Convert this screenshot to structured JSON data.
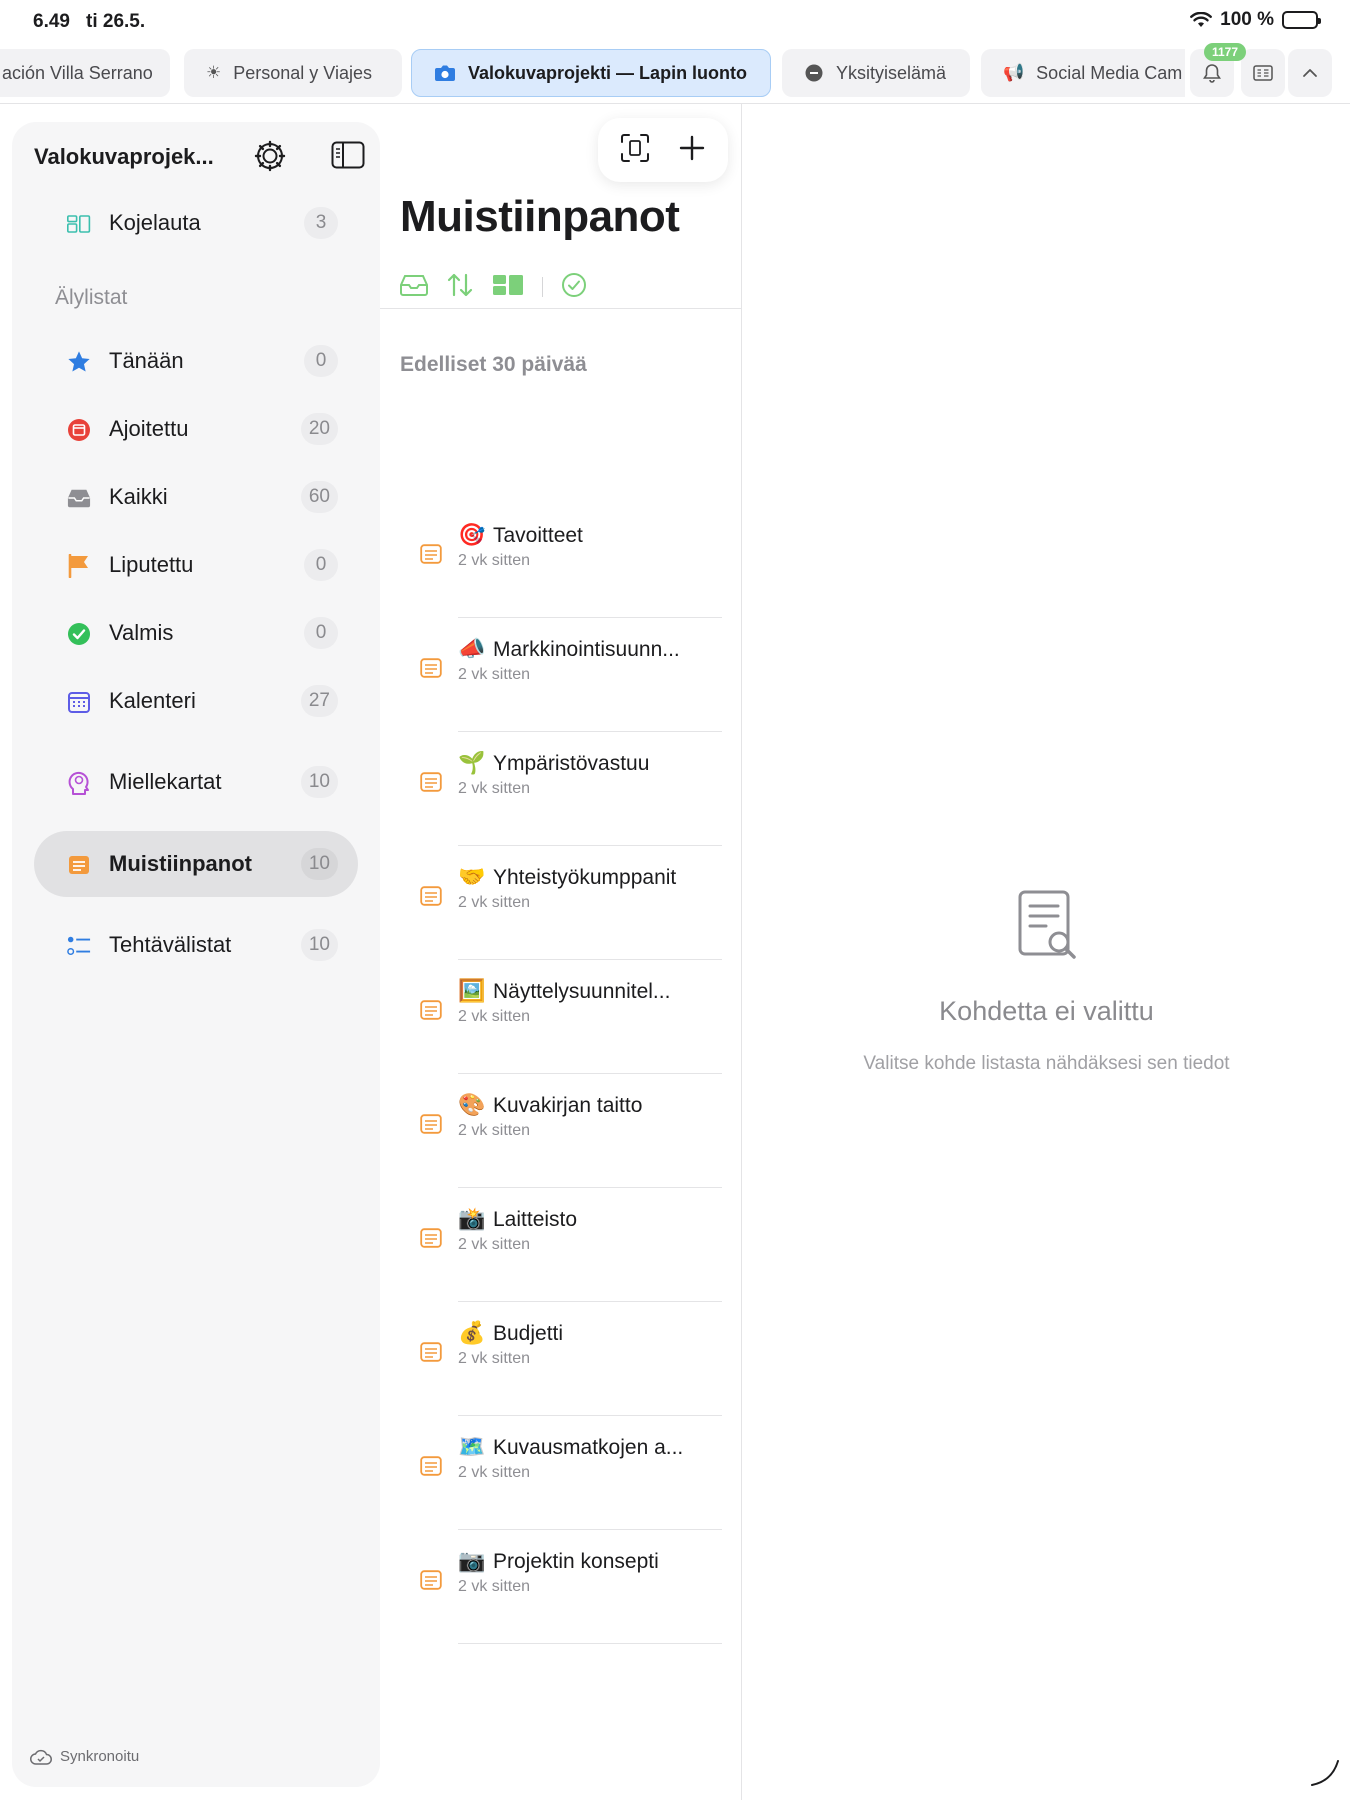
{
  "status": {
    "time": "6.49",
    "date": "ti 26.5.",
    "battery": "100 %"
  },
  "tabs": [
    {
      "label": "ación Villa Serrano",
      "icon": "none"
    },
    {
      "label": "Personal y Viajes",
      "icon": "sun-icon"
    },
    {
      "label": "Valokuvaprojekti — Lapin luonto",
      "icon": "camera-icon",
      "active": true
    },
    {
      "label": "Yksityiselämä",
      "icon": "chat-icon"
    },
    {
      "label": "Social Media Cam",
      "icon": "megaphone-icon"
    }
  ],
  "notifications_badge": "1177",
  "sidebar": {
    "title": "Valokuvaprojek...",
    "dashboard": {
      "label": "Kojelauta",
      "count": "3"
    },
    "smart_lists_label": "Älylistat",
    "items": [
      {
        "label": "Tänään",
        "count": "0",
        "icon": "star-icon"
      },
      {
        "label": "Ajoitettu",
        "count": "20",
        "icon": "scheduled-icon"
      },
      {
        "label": "Kaikki",
        "count": "60",
        "icon": "tray-icon"
      },
      {
        "label": "Liputettu",
        "count": "0",
        "icon": "flag-icon"
      },
      {
        "label": "Valmis",
        "count": "0",
        "icon": "checkmark-icon"
      },
      {
        "label": "Kalenteri",
        "count": "27",
        "icon": "calendar-icon"
      },
      {
        "label": "Miellekartat",
        "count": "10",
        "icon": "mindmap-icon"
      },
      {
        "label": "Muistiinpanot",
        "count": "10",
        "icon": "note-icon",
        "selected": true
      },
      {
        "label": "Tehtävälistat",
        "count": "10",
        "icon": "checklist-icon"
      }
    ],
    "sync_label": "Synkronoitu"
  },
  "list": {
    "title": "Muistiinpanot",
    "group_label": "Edelliset 30 päivää",
    "notes": [
      {
        "emoji": "🎯",
        "title": "Tavoitteet",
        "subtitle": "2 vk sitten"
      },
      {
        "emoji": "📣",
        "title": "Markkinointisuunn...",
        "subtitle": "2 vk sitten"
      },
      {
        "emoji": "🌱",
        "title": "Ympäristövastuu",
        "subtitle": "2 vk sitten"
      },
      {
        "emoji": "🤝",
        "title": "Yhteistyökumppanit",
        "subtitle": "2 vk sitten"
      },
      {
        "emoji": "🖼️",
        "title": "Näyttelysuunnitel...",
        "subtitle": "2 vk sitten"
      },
      {
        "emoji": "🎨",
        "title": "Kuvakirjan taitto",
        "subtitle": "2 vk sitten"
      },
      {
        "emoji": "📸",
        "title": "Laitteisto",
        "subtitle": "2 vk sitten"
      },
      {
        "emoji": "💰",
        "title": "Budjetti",
        "subtitle": "2 vk sitten"
      },
      {
        "emoji": "🗺️",
        "title": "Kuvausmatkojen a...",
        "subtitle": "2 vk sitten"
      },
      {
        "emoji": "📷",
        "title": "Projektin konsepti",
        "subtitle": "2 vk sitten"
      }
    ]
  },
  "detail": {
    "empty_title": "Kohdetta ei valittu",
    "empty_subtitle": "Valitse kohde listasta nähdäksesi sen tiedot"
  },
  "colors": {
    "accent_blue": "#2f7de1",
    "note_orange": "#f39a3d",
    "filter_green": "#7cd07a",
    "badge_green": "#7cd07a"
  }
}
